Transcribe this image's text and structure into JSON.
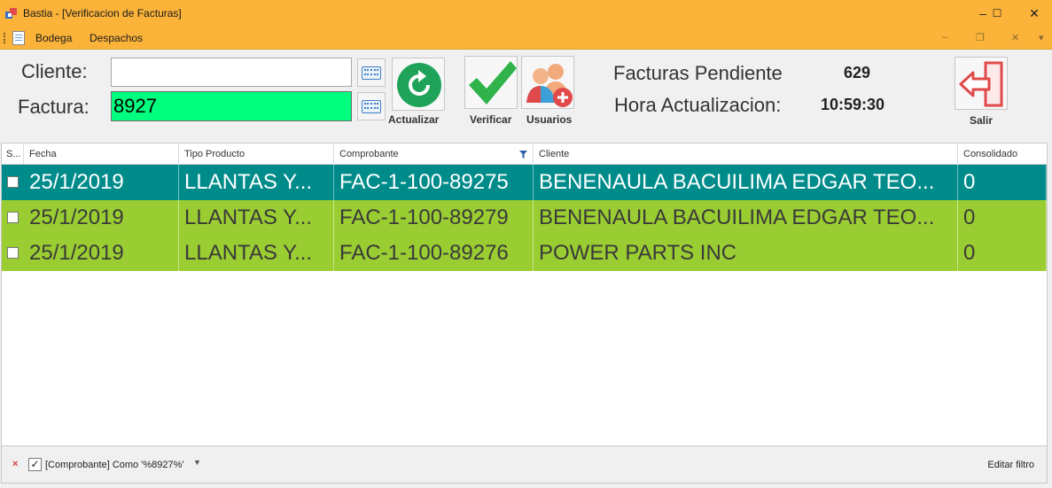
{
  "window": {
    "title": "Bastia - [Verificacion de Facturas]",
    "controls": {
      "minimize": "–",
      "maximize": "☐",
      "close": "✕"
    }
  },
  "menu": {
    "items": [
      "Bodega",
      "Despachos"
    ],
    "mdi": {
      "minimize": "–",
      "restore": "❐",
      "close": "✕",
      "more": "▾"
    }
  },
  "form": {
    "cliente_label": "Cliente:",
    "cliente_value": "",
    "factura_label": "Factura:",
    "factura_value": "8927"
  },
  "buttons": {
    "actualizar": "Actualizar",
    "verificar": "Verificar",
    "usuarios": "Usuarios",
    "salir": "Salir"
  },
  "info": {
    "pendiente_label": "Facturas Pendiente",
    "pendiente_value": "629",
    "hora_label": "Hora Actualizacion:",
    "hora_value": "10:59:30"
  },
  "grid": {
    "columns": [
      "S...",
      "Fecha",
      "Tipo Producto",
      "Comprobante",
      "Cliente",
      "Consolidado"
    ],
    "rows": [
      {
        "fecha": "25/1/2019",
        "tipo": "LLANTAS Y...",
        "comprobante": "FAC-1-100-89275",
        "cliente": "BENENAULA BACUILIMA EDGAR TEO...",
        "consolidado": "0",
        "color": "#008b8b"
      },
      {
        "fecha": "25/1/2019",
        "tipo": "LLANTAS Y...",
        "comprobante": "FAC-1-100-89279",
        "cliente": "BENENAULA BACUILIMA EDGAR TEO...",
        "consolidado": "0",
        "color": "#9acd32"
      },
      {
        "fecha": "25/1/2019",
        "tipo": "LLANTAS Y...",
        "comprobante": "FAC-1-100-89276",
        "cliente": "POWER PARTS INC",
        "consolidado": "0",
        "color": "#9acd32"
      }
    ]
  },
  "filter": {
    "clear": "×",
    "checked": "✓",
    "text": "[Comprobante] Como '%8927%'",
    "dropdown": "▼",
    "edit": "Editar filtro"
  },
  "colors": {
    "titlebar": "#fbb33a",
    "input_highlight": "#00ff7f",
    "row_selected": "#008b8b",
    "row_normal": "#9acd32"
  }
}
